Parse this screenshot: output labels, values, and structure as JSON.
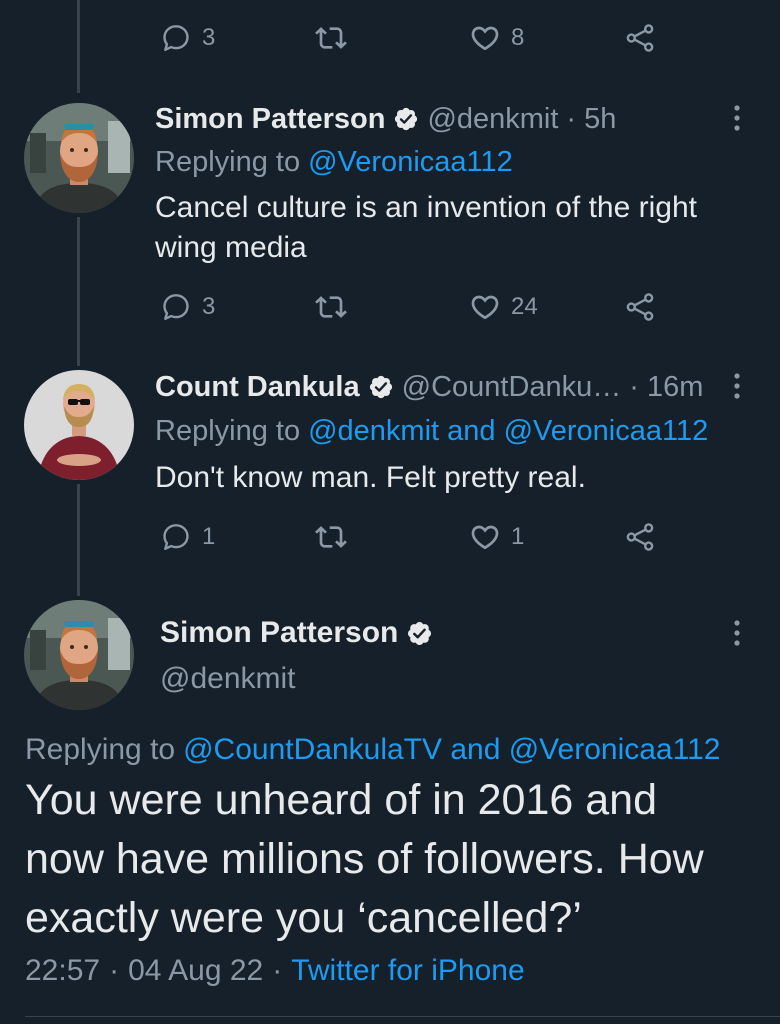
{
  "theme": {
    "background": "#15202b",
    "text_color": "#e7e9ea",
    "secondary_color": "#8b98a5",
    "link_color": "#1d9bf0",
    "thread_line_color": "#38444d"
  },
  "icons": {
    "reply": "reply-icon",
    "retweet": "retweet-icon",
    "like": "heart-icon",
    "share": "share-icon",
    "more": "more-vertical-icon",
    "verified": "verified-badge-icon"
  },
  "previous_tweet": {
    "reply_count": "3",
    "like_count": "8"
  },
  "thread_replies": [
    {
      "name": "Simon Patterson",
      "verified": true,
      "handle": "@denkmit",
      "separator": "·",
      "time": "5h",
      "replying_label": "Replying to",
      "replying_to": "@Veronicaa112",
      "text": "Cancel culture is an invention of the right wing media",
      "reply_count": "3",
      "like_count": "24"
    },
    {
      "name": "Count Dankula",
      "verified": true,
      "handle": "@CountDanku…",
      "separator": "·",
      "time": "16m",
      "replying_label": "Replying to",
      "replying_to": "@denkmit and @Veronicaa112",
      "text": "Don't know man. Felt pretty real.",
      "reply_count": "1",
      "like_count": "1"
    }
  ],
  "main_tweet": {
    "name": "Simon Patterson",
    "verified": true,
    "handle": "@denkmit",
    "replying_label": "Replying to",
    "replying_to": "@CountDankulaTV and @Veronicaa112",
    "text": "You were unheard of in 2016 and now have millions of followers. How exactly were you ‘cancelled?’",
    "time": "22:57",
    "separator": "·",
    "date": "04 Aug 22",
    "source": "Twitter for iPhone"
  }
}
